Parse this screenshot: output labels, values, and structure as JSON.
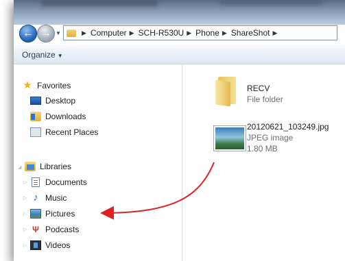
{
  "address": {
    "crumbs": [
      "Computer",
      "SCH-R530U",
      "Phone",
      "ShareShot"
    ]
  },
  "toolbar": {
    "organize_label": "Organize"
  },
  "navpane": {
    "favorites": {
      "label": "Favorites",
      "items": [
        "Desktop",
        "Downloads",
        "Recent Places"
      ]
    },
    "libraries": {
      "label": "Libraries",
      "items": [
        "Documents",
        "Music",
        "Pictures",
        "Podcasts",
        "Videos"
      ]
    }
  },
  "files": [
    {
      "name": "RECV",
      "type": "File folder",
      "size": ""
    },
    {
      "name": "20120621_103249.jpg",
      "type": "JPEG image",
      "size": "1.80 MB"
    }
  ],
  "colors": {
    "arrow": "#e02020",
    "toolbar_text": "#1e395b",
    "secondary_text": "#6d6d6d"
  }
}
